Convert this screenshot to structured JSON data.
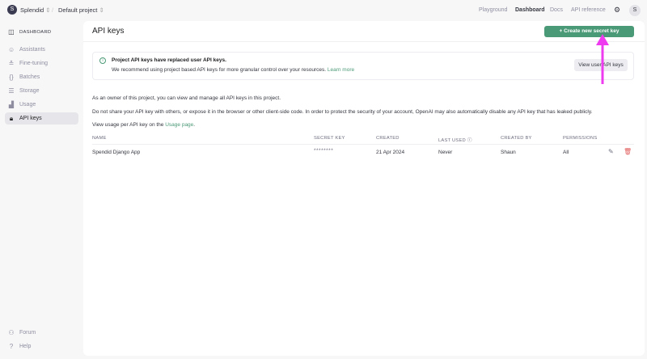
{
  "topbar": {
    "org": "Splendid",
    "org_initial": "S",
    "project": "Default project",
    "nav": [
      "Playground",
      "Dashboard",
      "Docs",
      "API reference"
    ],
    "active_nav": "Dashboard",
    "user_initial": "S"
  },
  "sidebar": {
    "header": "DASHBOARD",
    "items": [
      {
        "label": "Assistants",
        "icon": "assistant-icon"
      },
      {
        "label": "Fine-tuning",
        "icon": "sliders-icon"
      },
      {
        "label": "Batches",
        "icon": "batches-icon"
      },
      {
        "label": "Storage",
        "icon": "database-icon"
      },
      {
        "label": "Usage",
        "icon": "chart-icon"
      },
      {
        "label": "API keys",
        "icon": "lock-icon",
        "active": true
      }
    ],
    "footer": [
      {
        "label": "Forum",
        "icon": "people-icon"
      },
      {
        "label": "Help",
        "icon": "help-icon"
      }
    ]
  },
  "main": {
    "title": "API keys",
    "create_button": "Create new secret key",
    "notice": {
      "title": "Project API keys have replaced user API keys.",
      "body": "We recommend using project based API keys for more granular control over your resources.",
      "link": "Learn more",
      "button": "View user API keys"
    },
    "para1": "As an owner of this project, you can view and manage all API keys in this project.",
    "para2": "Do not share your API key with others, or expose it in the browser or other client-side code. In order to protect the security of your account, OpenAI may also automatically disable any API key that has leaked publicly.",
    "para3_prefix": "View usage per API key on the",
    "para3_link": "Usage page",
    "table": {
      "columns": [
        "NAME",
        "SECRET KEY",
        "CREATED",
        "LAST USED",
        "CREATED BY",
        "PERMISSIONS"
      ],
      "rows": [
        {
          "name": "Spendid Django App",
          "secret_key": "********",
          "created": "21 Apr 2024",
          "last_used": "Never",
          "created_by": "Shaun",
          "permissions": "All"
        }
      ]
    }
  },
  "colors": {
    "accent": "#4b9a77",
    "annotation": "#ee3bef",
    "delete": "#e05a5a"
  }
}
